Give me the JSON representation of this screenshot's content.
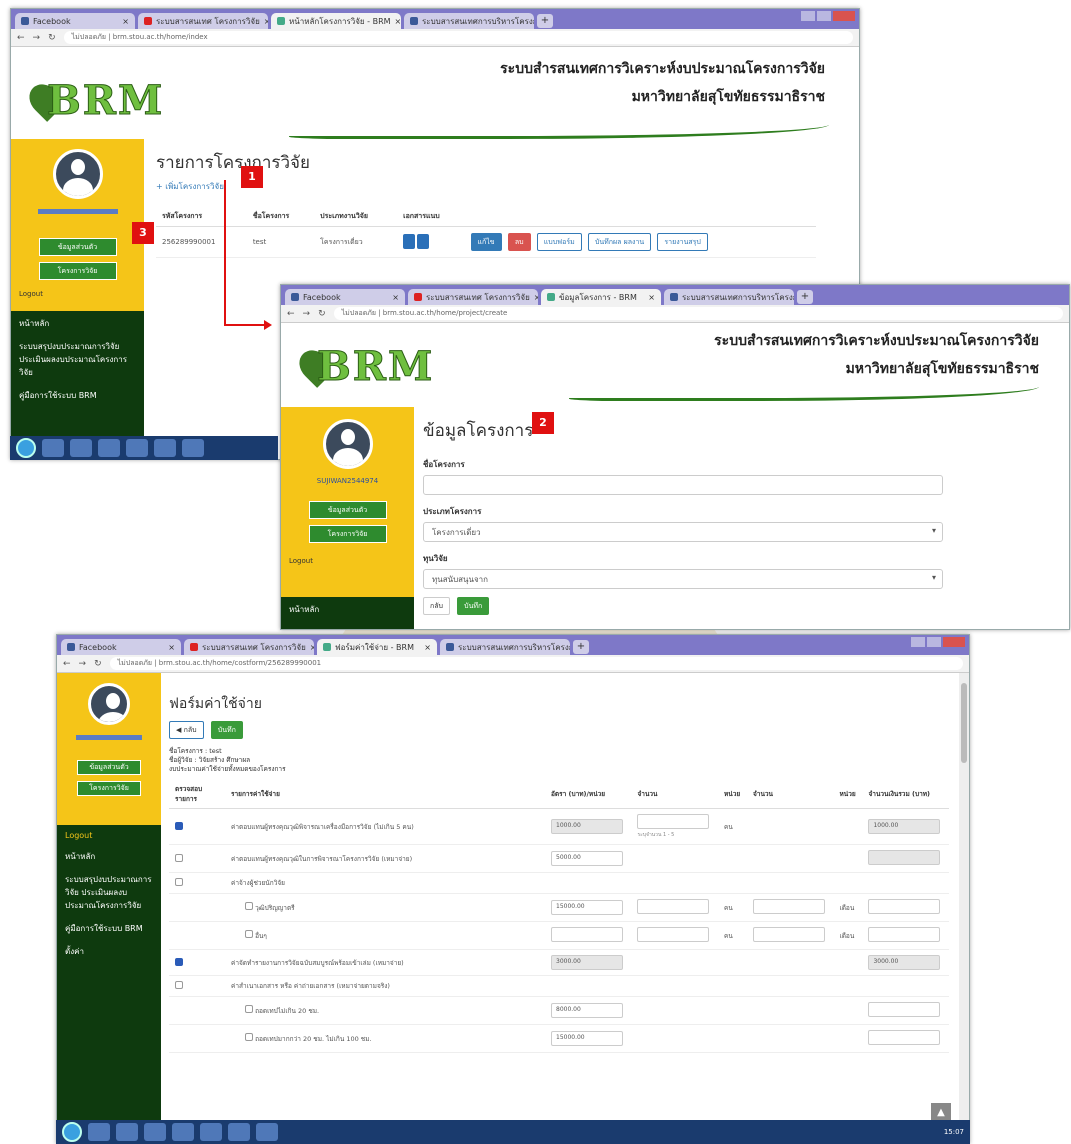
{
  "colors": {
    "sidebar_yellow": "#f5c518",
    "sidebar_green": "#0e3a0e",
    "marker_red": "#e01010",
    "tab_bar": "#7e78c8",
    "primary": "#337ab7"
  },
  "icons": [
    "brm-leaf-logo",
    "user-avatar-icon",
    "info-icon",
    "user-edit-icon",
    "home-icon",
    "document-icon",
    "back-arrow-icon",
    "checkbox-icon",
    "scroll-top-icon"
  ],
  "system": {
    "title_line1": "ระบบสำรสนเทศการวิเคราะห์งบประมาณโครงการวิจัย",
    "title_line2": "มหาวิทยาลัยสุโขทัยธรรมาธิราช",
    "logo_text": "BRM"
  },
  "markers": {
    "m1": "1",
    "m2": "2",
    "m3": "3"
  },
  "shot1": {
    "tabs": [
      "Facebook",
      "ระบบสารสนเทศ โครงการวิจัย",
      "หน้าหลักโครงการวิจัย - BRM",
      "ระบบสารสนเทศการบริหารโครงการ"
    ],
    "url": "ไม่ปลอดภัย | brm.stou.ac.th/home/index",
    "page_title": "รายการโครงการวิจัย",
    "add_link": "+ เพิ่มโครงการวิจัย",
    "table_headers": [
      "รหัสโครงการ",
      "ชื่อโครงการ",
      "ประเภทงานวิจัย",
      "เอกสารแนบ"
    ],
    "row": {
      "code": "256289990001",
      "name": "test",
      "type": "โครงการเดี่ยว"
    },
    "buttons": [
      "แก้ไข",
      "ลบ",
      "แบบฟอร์ม",
      "บันทึกผล ผลงาน",
      "รายงานสรุป"
    ],
    "sidebar": {
      "btn_info": "ข้อมูลส่วนตัว",
      "btn_edit": "โครงการวิจัย",
      "logout": "Logout",
      "nav": [
        "หน้าหลัก",
        "ระบบสรุปงบประมาณการวิจัย ประเมินผลงบประมาณโครงการวิจัย",
        "คู่มือการใช้ระบบ BRM"
      ]
    }
  },
  "shot2": {
    "tabs": [
      "Facebook",
      "ระบบสารสนเทศ โครงการวิจัย",
      "ข้อมูลโครงการ - BRM",
      "ระบบสารสนเทศการบริหารโครงการ"
    ],
    "url": "ไม่ปลอดภัย | brm.stou.ac.th/home/project/create",
    "page_title": "ข้อมูลโครงการ",
    "username": "SUJIWAN2544974",
    "label_name": "ชื่อโครงการ",
    "label_type": "ประเภทโครงการ",
    "type_value": "โครงการเดี่ยว",
    "label_fund": "ทุนวิจัย",
    "fund_value": "ทุนสนับสนุนจาก",
    "btn_back": "กลับ",
    "btn_save": "บันทึก",
    "sidebar": {
      "btn_info": "ข้อมูลส่วนตัว",
      "btn_edit": "โครงการวิจัย",
      "logout": "Logout",
      "nav": [
        "หน้าหลัก"
      ]
    }
  },
  "shot3": {
    "tabs": [
      "Facebook",
      "ระบบสารสนเทศ โครงการวิจัย",
      "ฟอร์มค่าใช้จ่าย - BRM",
      "ระบบสารสนเทศการบริหารโครงการ"
    ],
    "url": "ไม่ปลอดภัย | brm.stou.ac.th/home/costform/256289990001",
    "page_title": "ฟอร์มค่าใช้จ่าย",
    "btn_back": "กลับ",
    "btn_save": "บันทึก",
    "info_project": "ชื่อโครงการ  : test",
    "info_researcher": "ชื่อผู้วิจัย  : วิจัยสร้าง ศึกษาผล",
    "info_note": "งบประมาณค่าใช้จ่ายทั้งหมดของโครงการ",
    "headers": [
      "ตรวจสอบรายการ",
      "รายการค่าใช้จ่าย",
      "อัตรา (บาท)/หน่วย",
      "จำนวน",
      "หน่วย",
      "จำนวน",
      "หน่วย",
      "จำนวนเงินรวม (บาท)"
    ],
    "rows": [
      {
        "item": "ค่าตอบแทนผู้ทรงคุณวุฒิพิจารณาเครื่องมือการวิจัย (ไม่เกิน 5 คน)",
        "rate": "1000.00",
        "unit1": "คน",
        "total": "1000.00"
      },
      {
        "item": "ค่าตอบแทนผู้ทรงคุณวุฒิในการพิจารณาโครงการวิจัย (เหมาจ่าย)",
        "rate": "5000.00",
        "unit1": "",
        "total": ""
      },
      {
        "item": "ค่าจ้างผู้ช่วยนักวิจัย",
        "rate": "",
        "unit1": "",
        "total": ""
      },
      {
        "item": "วุฒิปริญญาตรี",
        "rate": "15000.00",
        "unit1": "คน",
        "unit2": "เดือน",
        "total": ""
      },
      {
        "item": "อื่นๆ",
        "rate": "",
        "unit1": "คน",
        "unit2": "เดือน",
        "total": ""
      },
      {
        "item": "ค่าจัดทำรายงานการวิจัยฉบับสมบูรณ์พร้อมเข้าเล่ม (เหมาจ่าย)",
        "rate": "3000.00",
        "unit1": "",
        "total": "3000.00"
      },
      {
        "item": "ค่าสำเนาเอกสาร หรือ ค่าถ่ายเอกสาร (เหมาจ่ายตามจริง)",
        "rate": "",
        "unit1": "",
        "total": ""
      },
      {
        "item": "ถอดเทปไม่เกิน 20 ชม.",
        "rate": "8000.00",
        "unit1": "",
        "total": ""
      },
      {
        "item": "ถอดเทปมากกว่า 20 ชม. ไม่เกิน 100 ชม.",
        "rate": "15000.00",
        "unit1": "",
        "total": ""
      }
    ],
    "hint_range": "ระบุจำนวน 1 - 5",
    "sidebar": {
      "btn_info": "ข้อมูลส่วนตัว",
      "btn_edit": "โครงการวิจัย",
      "logout": "Logout",
      "nav": [
        "หน้าหลัก",
        "ระบบสรุปงบประมาณการวิจัย ประเมินผลงบประมาณโครงการวิจัย",
        "คู่มือการใช้ระบบ BRM",
        "ตั้งค่า"
      ]
    },
    "tray_time": "15:07"
  }
}
